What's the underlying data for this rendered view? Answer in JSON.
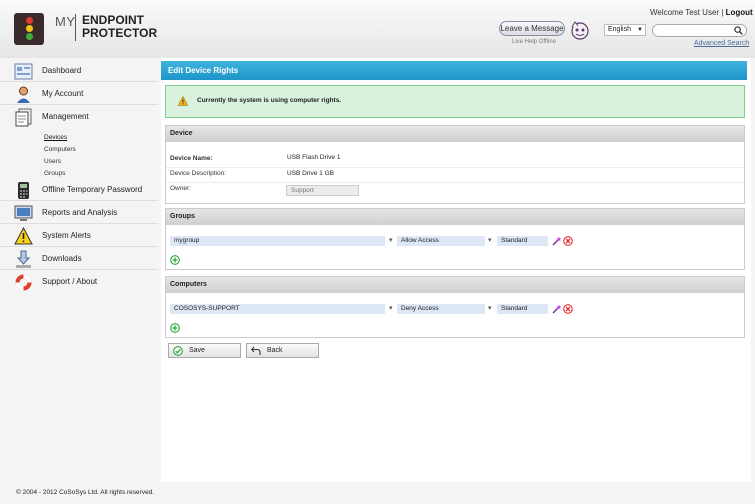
{
  "header": {
    "logo_my": "MY",
    "logo_line1": "ENDPOINT",
    "logo_line2": "PROTECTOR",
    "welcome_prefix": "Welcome Test User",
    "welcome_sep": "|",
    "logout": "Logout",
    "leave_message": "Leave a Message",
    "live_help": "Live Help Offline",
    "language": "English",
    "search_value": "",
    "advanced_search": "Advanced Search"
  },
  "sidebar": {
    "items": [
      {
        "label": "Dashboard",
        "icon": "dashboard-icon"
      },
      {
        "label": "My Account",
        "icon": "user-icon"
      },
      {
        "label": "Management",
        "icon": "documents-icon"
      },
      {
        "label": "Offline Temporary Password",
        "icon": "calculator-icon"
      },
      {
        "label": "Reports and Analysis",
        "icon": "monitor-icon"
      },
      {
        "label": "System Alerts",
        "icon": "warning-icon"
      },
      {
        "label": "Downloads",
        "icon": "download-icon"
      },
      {
        "label": "Support / About",
        "icon": "lifebuoy-icon"
      }
    ],
    "subitems": [
      "Devices",
      "Computers",
      "Users",
      "Groups"
    ]
  },
  "main": {
    "title": "Edit Device Rights",
    "alert": "Currently the system is using computer rights.",
    "device": {
      "header": "Device",
      "name_label": "Device Name:",
      "name_value": "USB Flash Drive 1",
      "desc_label": "Device Description:",
      "desc_value": "USB Drive 1 GB",
      "owner_label": "Owner:",
      "owner_value": "Support"
    },
    "groups": {
      "header": "Groups",
      "rows": [
        {
          "name": "mygroup",
          "access": "Allow Access",
          "level": "Standard"
        }
      ]
    },
    "computers": {
      "header": "Computers",
      "rows": [
        {
          "name": "COSOSYS-SUPPORT",
          "access": "Deny Access",
          "level": "Standard"
        }
      ]
    },
    "save": "Save",
    "back": "Back"
  },
  "footer": "© 2004 - 2012 CoSoSys Ltd. All rights reserved.",
  "colors": {
    "accent": "#1d95c8",
    "alert_bg": "#d9f2dd",
    "input_bg": "#dde7f5"
  }
}
